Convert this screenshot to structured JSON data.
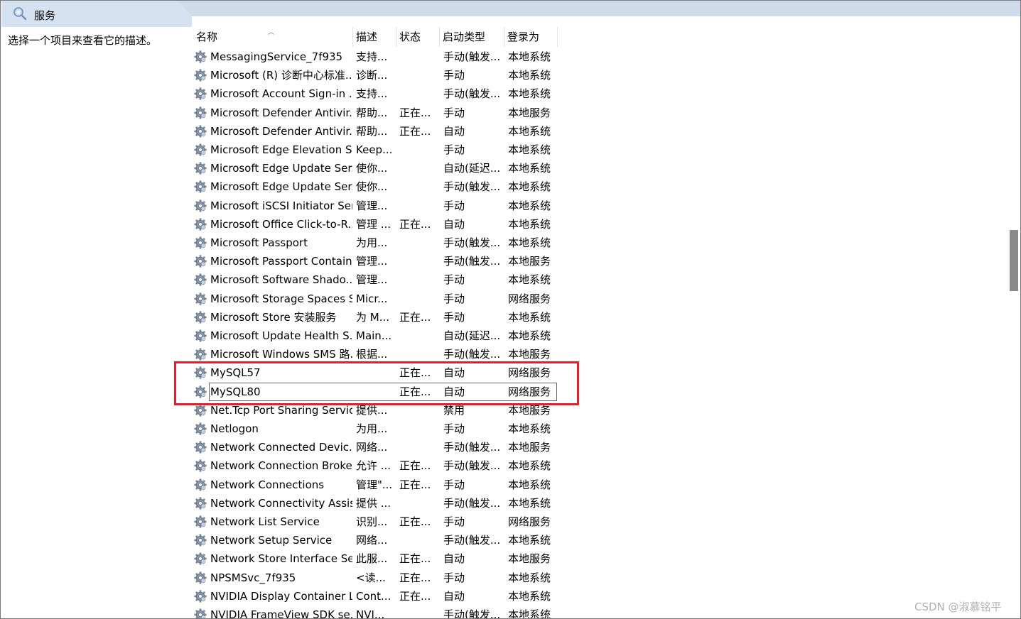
{
  "window": {
    "title": "服务",
    "title_icon": "search-services-icon"
  },
  "left_pane": {
    "description": "选择一个项目来查看它的描述。"
  },
  "columns": {
    "name": "名称",
    "desc": "描述",
    "status": "状态",
    "startup": "启动类型",
    "logon": "登录为"
  },
  "rows": [
    {
      "name": "MessagingService_7f935",
      "desc": "支持...",
      "status": "",
      "startup": "手动(触发...",
      "logon": "本地系统"
    },
    {
      "name": "Microsoft (R) 诊断中心标准...",
      "desc": "诊断...",
      "status": "",
      "startup": "手动",
      "logon": "本地系统"
    },
    {
      "name": "Microsoft Account Sign-in ...",
      "desc": "支持...",
      "status": "",
      "startup": "手动(触发...",
      "logon": "本地系统"
    },
    {
      "name": "Microsoft Defender Antivir...",
      "desc": "帮助...",
      "status": "正在...",
      "startup": "手动",
      "logon": "本地服务"
    },
    {
      "name": "Microsoft Defender Antivir...",
      "desc": "帮助...",
      "status": "正在...",
      "startup": "自动",
      "logon": "本地系统"
    },
    {
      "name": "Microsoft Edge Elevation S...",
      "desc": "Keep...",
      "status": "",
      "startup": "手动",
      "logon": "本地系统"
    },
    {
      "name": "Microsoft Edge Update Ser...",
      "desc": "使你...",
      "status": "",
      "startup": "自动(延迟...",
      "logon": "本地系统"
    },
    {
      "name": "Microsoft Edge Update Ser...",
      "desc": "使你...",
      "status": "",
      "startup": "手动(触发...",
      "logon": "本地系统"
    },
    {
      "name": "Microsoft iSCSI Initiator Ser...",
      "desc": "管理...",
      "status": "",
      "startup": "手动",
      "logon": "本地系统"
    },
    {
      "name": "Microsoft Office Click-to-R...",
      "desc": "管理 ...",
      "status": "正在...",
      "startup": "自动",
      "logon": "本地系统"
    },
    {
      "name": "Microsoft Passport",
      "desc": "为用...",
      "status": "",
      "startup": "手动(触发...",
      "logon": "本地系统"
    },
    {
      "name": "Microsoft Passport Container",
      "desc": "管理...",
      "status": "",
      "startup": "手动(触发...",
      "logon": "本地服务"
    },
    {
      "name": "Microsoft Software Shado...",
      "desc": "管理...",
      "status": "",
      "startup": "手动",
      "logon": "本地系统"
    },
    {
      "name": "Microsoft Storage Spaces S...",
      "desc": "Micr...",
      "status": "",
      "startup": "手动",
      "logon": "网络服务"
    },
    {
      "name": "Microsoft Store 安装服务",
      "desc": "为 M...",
      "status": "正在...",
      "startup": "手动",
      "logon": "本地系统"
    },
    {
      "name": "Microsoft Update Health S...",
      "desc": "Main...",
      "status": "",
      "startup": "自动(延迟...",
      "logon": "本地系统"
    },
    {
      "name": "Microsoft Windows SMS 路...",
      "desc": "根据...",
      "status": "",
      "startup": "手动(触发...",
      "logon": "本地服务"
    },
    {
      "name": "MySQL57",
      "desc": "",
      "status": "正在...",
      "startup": "自动",
      "logon": "网络服务"
    },
    {
      "name": "MySQL80",
      "desc": "",
      "status": "正在...",
      "startup": "自动",
      "logon": "网络服务"
    },
    {
      "name": "Net.Tcp Port Sharing Service",
      "desc": "提供...",
      "status": "",
      "startup": "禁用",
      "logon": "本地服务"
    },
    {
      "name": "Netlogon",
      "desc": "为用...",
      "status": "",
      "startup": "手动",
      "logon": "本地系统"
    },
    {
      "name": "Network Connected Devic...",
      "desc": "网络...",
      "status": "",
      "startup": "手动(触发...",
      "logon": "本地服务"
    },
    {
      "name": "Network Connection Broker",
      "desc": "允许 ...",
      "status": "正在...",
      "startup": "手动(触发...",
      "logon": "本地系统"
    },
    {
      "name": "Network Connections",
      "desc": "管理\"...",
      "status": "正在...",
      "startup": "手动",
      "logon": "本地系统"
    },
    {
      "name": "Network Connectivity Assis...",
      "desc": "提供 ...",
      "status": "",
      "startup": "手动(触发...",
      "logon": "本地系统"
    },
    {
      "name": "Network List Service",
      "desc": "识别...",
      "status": "正在...",
      "startup": "手动",
      "logon": "网络服务"
    },
    {
      "name": "Network Setup Service",
      "desc": "网络...",
      "status": "",
      "startup": "手动(触发...",
      "logon": "本地系统"
    },
    {
      "name": "Network Store Interface Se...",
      "desc": "此服...",
      "status": "正在...",
      "startup": "自动",
      "logon": "本地服务"
    },
    {
      "name": "NPSMSvc_7f935",
      "desc": "<读...",
      "status": "正在...",
      "startup": "手动",
      "logon": "本地系统"
    },
    {
      "name": "NVIDIA Display Container LS",
      "desc": "Cont...",
      "status": "正在...",
      "startup": "自动",
      "logon": "本地系统"
    },
    {
      "name": "NVIDIA FrameView SDK se...",
      "desc": "NVI...",
      "status": "",
      "startup": "手动(触发...",
      "logon": "本地系统"
    }
  ],
  "focused_row_index": 18,
  "annotation": {
    "color": "#e0202c"
  },
  "watermark": "CSDN @淑慕铭平"
}
